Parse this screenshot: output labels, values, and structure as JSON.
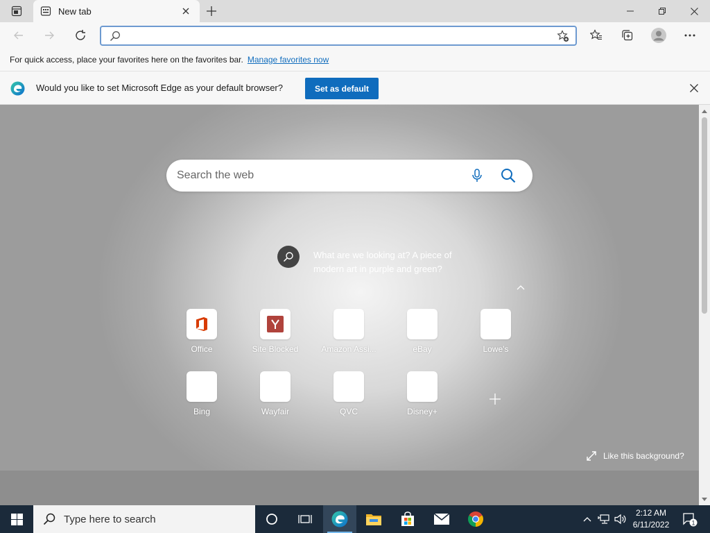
{
  "tab": {
    "title": "New tab",
    "icon": "new-tab-page-icon"
  },
  "address_bar": {
    "value": "",
    "placeholder": ""
  },
  "favorites_bar": {
    "message": "For quick access, place your favorites here on the favorites bar.",
    "link": "Manage favorites now"
  },
  "default_banner": {
    "message": "Would you like to set Microsoft Edge as your default browser?",
    "button": "Set as default"
  },
  "new_tab_page": {
    "search_placeholder": "Search the web",
    "visual_caption": "What are we looking at? A piece of modern art in purple and green?",
    "like_background": "Like this background?",
    "quick_links": [
      {
        "label": "Office",
        "icon": "office-logo"
      },
      {
        "label": "Site Blocked",
        "icon": "site-blocked-logo"
      },
      {
        "label": "Amazon Assi...",
        "icon": "blank"
      },
      {
        "label": "eBay",
        "icon": "blank"
      },
      {
        "label": "Lowe's",
        "icon": "blank"
      },
      {
        "label": "Bing",
        "icon": "blank"
      },
      {
        "label": "Wayfair",
        "icon": "blank"
      },
      {
        "label": "QVC",
        "icon": "blank"
      },
      {
        "label": "Disney+",
        "icon": "blank"
      }
    ]
  },
  "taskbar": {
    "search_placeholder": "Type here to search",
    "time": "2:12 AM",
    "date": "6/11/2022",
    "notification_count": "1",
    "pinned": [
      "cortana-icon",
      "task-view-icon",
      "edge-icon",
      "file-explorer-icon",
      "store-icon",
      "mail-icon",
      "chrome-icon"
    ]
  },
  "colors": {
    "accent": "#0f6cbd",
    "taskbar": "#1b2a3a",
    "address_border": "#6d9ad0"
  }
}
